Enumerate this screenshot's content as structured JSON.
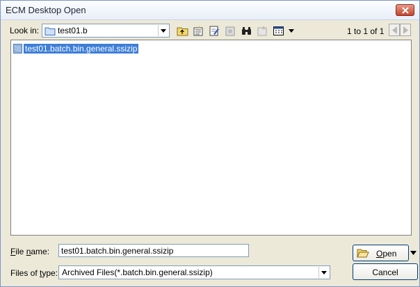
{
  "window": {
    "title": "ECM Desktop Open"
  },
  "lookin": {
    "label": "Look in:",
    "value": "test01.b",
    "page_info": "1 to 1 of 1"
  },
  "files": [
    {
      "name": "test01.batch.bin.general.ssizip",
      "selected": true
    }
  ],
  "filename": {
    "label": "File name:",
    "value": "test01.batch.bin.general.ssizip"
  },
  "filetype": {
    "label": "Files of type:",
    "value": "Archived Files(*.batch.bin.general.ssizip)"
  },
  "buttons": {
    "open": "Open",
    "cancel": "Cancel"
  },
  "colors": {
    "selection": "#3d7ed8",
    "titlebar": "#eef3fb",
    "close": "#c2452f",
    "face": "#ece9d8"
  },
  "icons": [
    "close-icon",
    "folder-icon",
    "up-folder-icon",
    "properties-icon",
    "edit-icon",
    "checkin-icon",
    "find-icon",
    "favorites-icon",
    "view-menu-icon",
    "prev-page-icon",
    "next-page-icon",
    "file-icon",
    "open-folder-icon"
  ]
}
